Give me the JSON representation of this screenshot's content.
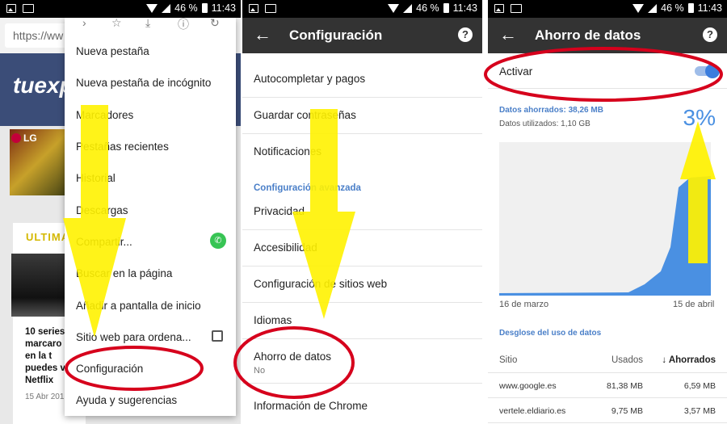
{
  "status": {
    "battery": "46 %",
    "time": "11:43"
  },
  "browser": {
    "url_text": "https://ww",
    "site_logo": "tuexp",
    "ad_badge": "LG",
    "card_heading": "ULTIMA",
    "card_text": "10 series\nmarcaro\nen la t\npuedes v\nNetflix",
    "card_date": "15 Abr 201",
    "menu_items": [
      "Nueva pestaña",
      "Nueva pestaña de incógnito",
      "Marcadores",
      "Pestañas recientes",
      "Historial",
      "Descargas",
      "Compartir...",
      "Buscar en la página",
      "Añadir a pantalla de inicio",
      "Sitio web para ordena...",
      "Configuración",
      "Ayuda y sugerencias"
    ]
  },
  "settings": {
    "title": "Configuración",
    "items": [
      "Autocompletar y pagos",
      "Guardar contraseñas",
      "Notificaciones"
    ],
    "advanced_header": "Configuración avanzada",
    "advanced_items": [
      "Privacidad",
      "Accesibilidad",
      "Configuración de sitios web",
      "Idiomas"
    ],
    "data_saver_label": "Ahorro de datos",
    "data_saver_value": "No",
    "chrome_info": "Información de Chrome"
  },
  "data_saver": {
    "title": "Ahorro de datos",
    "toggle_label": "Activar",
    "toggle_on": true,
    "saved_text": "Datos ahorrados: 38,26 MB",
    "used_text": "Datos utilizados: 1,10 GB",
    "percent": "3%",
    "date_start": "16 de marzo",
    "date_end": "15 de abril",
    "breakdown_header": "Desglose del uso de datos",
    "table": {
      "headers": [
        "Sitio",
        "Usados",
        "↓ Ahorrados"
      ],
      "rows": [
        [
          "www.google.es",
          "81,38 MB",
          "6,59 MB"
        ],
        [
          "vertele.eldiario.es",
          "9,75 MB",
          "3,57 MB"
        ]
      ]
    }
  },
  "colors": {
    "accent": "#4a7fc8",
    "chart_fill": "#4a90e2",
    "annotation_red": "#d6001c",
    "arrow_yellow": "#fff200"
  }
}
